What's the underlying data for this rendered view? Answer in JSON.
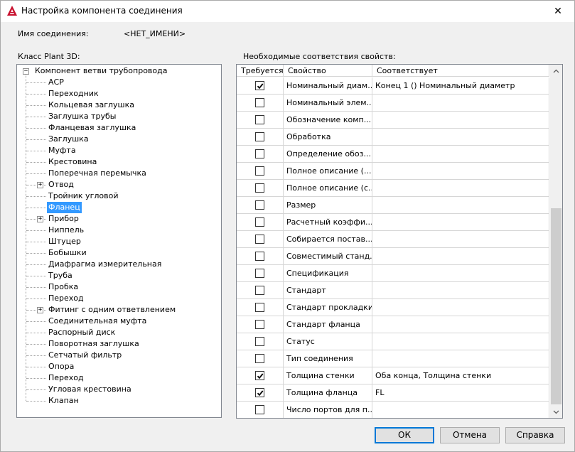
{
  "window": {
    "title": "Настройка компонента соединения",
    "close_glyph": "✕"
  },
  "connection": {
    "name_label": "Имя соединения:",
    "name_value": "<НЕТ_ИМЕНИ>"
  },
  "class_panel": {
    "label": "Класс Plant 3D:",
    "root": "Компонент ветви трубопровода",
    "items": [
      {
        "label": "АСР",
        "expandable": false
      },
      {
        "label": "Переходник",
        "expandable": false
      },
      {
        "label": "Кольцевая заглушка",
        "expandable": false
      },
      {
        "label": "Заглушка трубы",
        "expandable": false
      },
      {
        "label": "Фланцевая заглушка",
        "expandable": false
      },
      {
        "label": "Заглушка",
        "expandable": false
      },
      {
        "label": "Муфта",
        "expandable": false
      },
      {
        "label": "Крестовина",
        "expandable": false
      },
      {
        "label": "Поперечная перемычка",
        "expandable": false
      },
      {
        "label": "Отвод",
        "expandable": true
      },
      {
        "label": "Тройник угловой",
        "expandable": false
      },
      {
        "label": "Фланец",
        "expandable": false,
        "selected": true
      },
      {
        "label": "Прибор",
        "expandable": true
      },
      {
        "label": "Ниппель",
        "expandable": false
      },
      {
        "label": "Штуцер",
        "expandable": false
      },
      {
        "label": "Бобышки",
        "expandable": false
      },
      {
        "label": "Диафрагма измерительная",
        "expandable": false
      },
      {
        "label": "Труба",
        "expandable": false
      },
      {
        "label": "Пробка",
        "expandable": false
      },
      {
        "label": "Переход",
        "expandable": false
      },
      {
        "label": "Фитинг с одним ответвлением",
        "expandable": true
      },
      {
        "label": "Соединительная муфта",
        "expandable": false
      },
      {
        "label": "Распорный диск",
        "expandable": false
      },
      {
        "label": "Поворотная заглушка",
        "expandable": false
      },
      {
        "label": "Сетчатый фильтр",
        "expandable": false
      },
      {
        "label": "Опора",
        "expandable": false
      },
      {
        "label": "Переход",
        "expandable": false
      },
      {
        "label": "Угловая крестовина",
        "expandable": false
      },
      {
        "label": "Клапан",
        "expandable": false
      }
    ]
  },
  "mapping_panel": {
    "label": "Необходимые соответствия свойств:",
    "columns": [
      "Требуется",
      "Свойство",
      "Соответствует"
    ],
    "rows": [
      {
        "required": true,
        "property": "Номинальный диам...",
        "mapping": "Конец 1 () Номинальный диаметр"
      },
      {
        "required": false,
        "property": "Номинальный элем...",
        "mapping": ""
      },
      {
        "required": false,
        "property": "Обозначение комп...",
        "mapping": ""
      },
      {
        "required": false,
        "property": "Обработка",
        "mapping": ""
      },
      {
        "required": false,
        "property": "Определение обоз...",
        "mapping": ""
      },
      {
        "required": false,
        "property": "Полное описание (...",
        "mapping": ""
      },
      {
        "required": false,
        "property": "Полное описание (с...",
        "mapping": ""
      },
      {
        "required": false,
        "property": "Размер",
        "mapping": ""
      },
      {
        "required": false,
        "property": "Расчетный коэффи...",
        "mapping": ""
      },
      {
        "required": false,
        "property": "Собирается постав...",
        "mapping": ""
      },
      {
        "required": false,
        "property": "Совместимый станд...",
        "mapping": ""
      },
      {
        "required": false,
        "property": "Спецификация",
        "mapping": ""
      },
      {
        "required": false,
        "property": "Стандарт",
        "mapping": ""
      },
      {
        "required": false,
        "property": "Стандарт прокладки",
        "mapping": ""
      },
      {
        "required": false,
        "property": "Стандарт фланца",
        "mapping": ""
      },
      {
        "required": false,
        "property": "Статус",
        "mapping": ""
      },
      {
        "required": false,
        "property": "Тип соединения",
        "mapping": ""
      },
      {
        "required": true,
        "property": "Толщина стенки",
        "mapping": "Оба конца, Толщина стенки"
      },
      {
        "required": true,
        "property": "Толщина фланца",
        "mapping": "FL"
      },
      {
        "required": false,
        "property": "Число портов для п...",
        "mapping": ""
      }
    ]
  },
  "buttons": {
    "ok": "ОК",
    "cancel": "Отмена",
    "help": "Справка"
  },
  "colors": {
    "selection": "#3399ff",
    "default_button_border": "#0078d7",
    "app_icon": "#c8102e"
  },
  "icons": {
    "app": "autocad-icon",
    "close": "close-icon",
    "expander": "plus-icon",
    "scroll_up": "chevron-up-icon",
    "scroll_down": "chevron-down-icon",
    "check": "checkmark-icon"
  }
}
